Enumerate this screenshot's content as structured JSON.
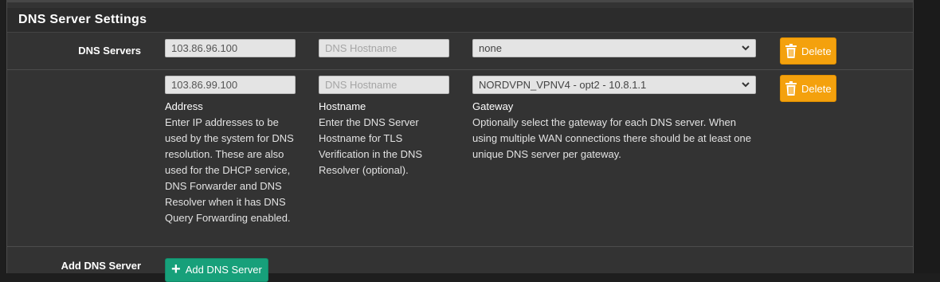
{
  "section": {
    "title": "DNS Server Settings"
  },
  "dns_servers_label": "DNS Servers",
  "servers": [
    {
      "address": "103.86.96.100",
      "hostname_placeholder": "DNS Hostname",
      "gateway": "none",
      "delete_label": "Delete"
    },
    {
      "address": "103.86.99.100",
      "hostname_placeholder": "DNS Hostname",
      "gateway": "NORDVPN_VPNV4 - opt2 - 10.8.1.1",
      "delete_label": "Delete"
    }
  ],
  "help": {
    "address_title": "Address",
    "address_text": "Enter IP addresses to be used by the system for DNS resolution. These are also used for the DHCP service, DNS Forwarder and DNS Resolver when it has DNS Query Forwarding enabled.",
    "hostname_title": "Hostname",
    "hostname_text": "Enter the DNS Server Hostname for TLS Verification in the DNS Resolver (optional).",
    "gateway_title": "Gateway",
    "gateway_text": "Optionally select the gateway for each DNS server. When using multiple WAN connections there should be at least one unique DNS server per gateway."
  },
  "add": {
    "label": "Add DNS Server",
    "button_label": "Add DNS Server"
  },
  "colors": {
    "delete_button": "#f4a10d",
    "add_button": "#17a07a",
    "panel_bg": "#333333"
  }
}
